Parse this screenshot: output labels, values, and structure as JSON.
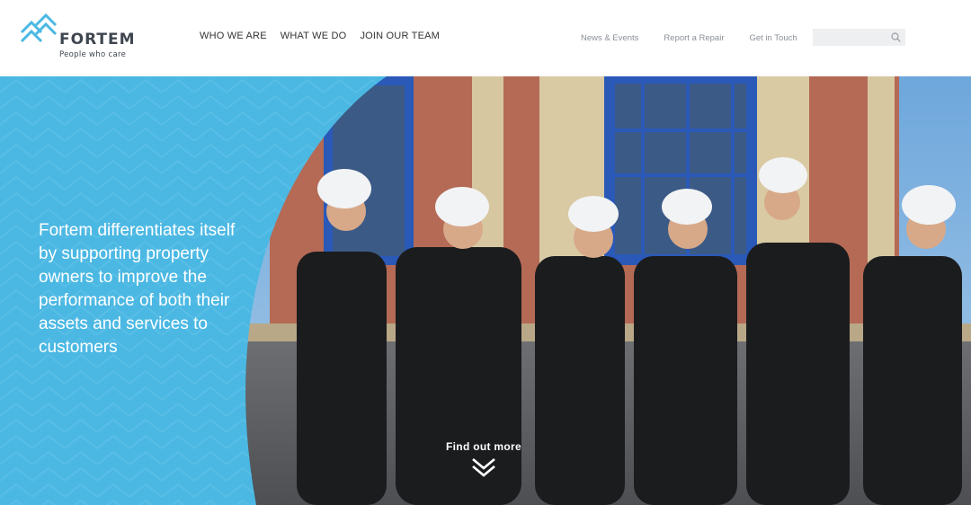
{
  "brand": {
    "name": "FORTEM",
    "tagline": "People who care",
    "accent": "#4bb8e3",
    "text_color": "#3f4650"
  },
  "main_nav": [
    {
      "label": "WHO WE ARE"
    },
    {
      "label": "WHAT WE DO"
    },
    {
      "label": "JOIN OUR TEAM"
    }
  ],
  "util_nav": [
    {
      "label": "News & Events"
    },
    {
      "label": "Report a Repair"
    },
    {
      "label": "Get in Touch"
    }
  ],
  "search": {
    "placeholder": "",
    "icon": "search-icon"
  },
  "hero": {
    "headline": "Fortem differentiates itself by supporting property owners to improve the performance of both their assets and services to customers",
    "cta_label": "Find out more",
    "cta_icon": "double-chevron-down-icon",
    "overlay_color": "#4bb8e3",
    "image": "photo of six women in black uniforms and white hard hats walking arm in arm in front of a brick building"
  }
}
